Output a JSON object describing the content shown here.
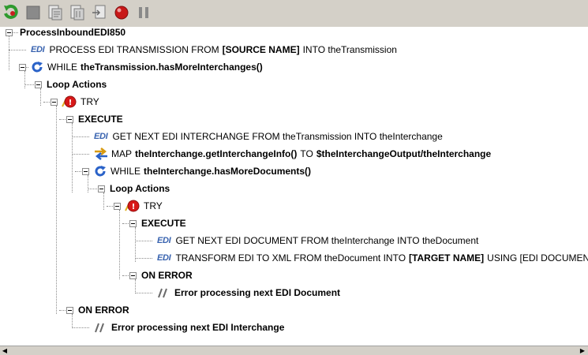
{
  "toolbar": {
    "buttons": [
      {
        "name": "run-icon"
      },
      {
        "name": "stop-icon"
      },
      {
        "name": "step-into-icon"
      },
      {
        "name": "step-over-icon"
      },
      {
        "name": "step-out-icon"
      },
      {
        "name": "breakpoint-icon"
      },
      {
        "name": "pause-icon"
      }
    ]
  },
  "tree": {
    "root": "ProcessInboundEDI850",
    "rows": {
      "r1_tag": "EDI",
      "r1_a": "PROCESS EDI TRANSMISSION FROM",
      "r1_b": "[SOURCE NAME]",
      "r1_c": "INTO theTransmission",
      "r2_a": "WHILE",
      "r2_b": "theTransmission.hasMoreInterchanges()",
      "r3": "Loop Actions",
      "r4": "TRY",
      "r5": "EXECUTE",
      "r6_tag": "EDI",
      "r6": "GET NEXT EDI INTERCHANGE FROM theTransmission INTO theInterchange",
      "r7_a": "MAP",
      "r7_b": "theInterchange.getInterchangeInfo()",
      "r7_c": "TO",
      "r7_d": "$theInterchangeOutput/theInterchange",
      "r8_a": "WHILE",
      "r8_b": "theInterchange.hasMoreDocuments()",
      "r9": "Loop Actions",
      "r10": "TRY",
      "r11": "EXECUTE",
      "r12_tag": "EDI",
      "r12": "GET NEXT EDI DOCUMENT FROM theInterchange INTO theDocument",
      "r13_tag": "EDI",
      "r13_a": "TRANSFORM EDI TO XML FROM theDocument INTO",
      "r13_b": "[TARGET NAME]",
      "r13_c": "USING [EDI DOCUMENT",
      "r14": "ON ERROR",
      "r15": "Error processing next EDI Document",
      "r16": "ON ERROR",
      "r17": "Error processing next EDI Interchange"
    }
  },
  "colors": {
    "edi_tag": "#3a64b0",
    "loop_icon": "#2a62c8",
    "try_icon": "#d81818"
  }
}
